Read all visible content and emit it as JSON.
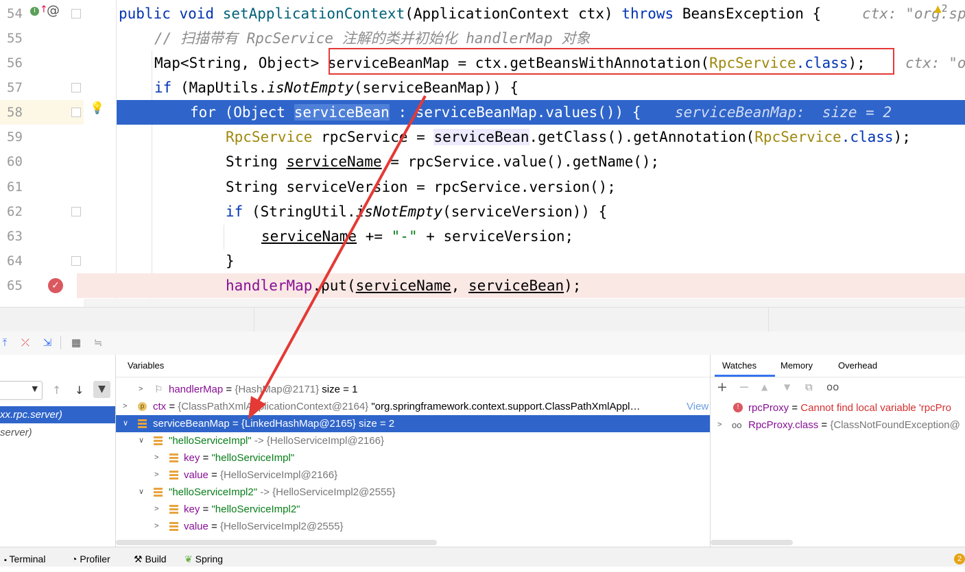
{
  "editor": {
    "lines": [
      {
        "num": "54"
      },
      {
        "num": "55"
      },
      {
        "num": "56"
      },
      {
        "num": "57"
      },
      {
        "num": "58"
      },
      {
        "num": "59"
      },
      {
        "num": "60"
      },
      {
        "num": "61"
      },
      {
        "num": "62"
      },
      {
        "num": "63"
      },
      {
        "num": "64"
      },
      {
        "num": "65"
      }
    ],
    "line54": {
      "t1": "public void ",
      "t2": "setApplicationContext",
      "t3": "(ApplicationContext ctx) ",
      "t4": "throws ",
      "t5": "BeansException {",
      "hint": "ctx: \"org.sp"
    },
    "line55": {
      "comment": "// 扫描带有 RpcService 注解的类并初始化 handlerMap 对象"
    },
    "line56": {
      "t1": "Map<String, Object> ",
      "t2": "serviceBeanMap = ctx.getBeansWithAnnotation(",
      "t3": "RpcService",
      "t4": ".class",
      "t5": ");",
      "hint": "ctx: \"o"
    },
    "line57": {
      "t1": "if ",
      "t2": "(MapUtils.",
      "t3": "isNotEmpty",
      "t4": "(serviceBeanMap)) {"
    },
    "line58": {
      "t1": "for ",
      "t2": "(Object ",
      "t3": "serviceBean",
      "t4": " : serviceBeanMap.values()) {",
      "hint": "serviceBeanMap:  size = 2"
    },
    "line59": {
      "t1": "RpcService",
      "t2": " rpcService = ",
      "t3": "serviceBean",
      "t4": ".getClass().getAnnotation(",
      "t5": "RpcService",
      ".class": "",
      "t6": ".class",
      "t7": ");"
    },
    "line60": {
      "t1": "String ",
      "t2": "serviceName",
      "t3": " = rpcService.value().getName();"
    },
    "line61": {
      "t1": "String serviceVersion = rpcService.version();"
    },
    "line62": {
      "t1": "if ",
      "t2": "(StringUtil.",
      "t3": "isNotEmpty",
      "t4": "(serviceVersion)) {"
    },
    "line63": {
      "t1": "serviceName",
      "t2": " += ",
      "t3": "\"-\"",
      "t4": " + serviceVersion;"
    },
    "line64": {
      "t1": "}"
    },
    "line65": {
      "t1": "handlerMap",
      "t2": ".put(",
      "t3": "serviceName",
      ", ": "",
      "t4": ", ",
      "t5": "serviceBean",
      "t6": ");"
    },
    "warnings": "2"
  },
  "variables": {
    "header": "Variables",
    "rows": [
      {
        "name": "handlerMap",
        "eq": " = ",
        "val": "{HashMap@2171}",
        "extra": "  size = 1"
      },
      {
        "name": "ctx",
        "eq": " = ",
        "val": "{ClassPathXmlApplicationContext@2164}",
        "extra": " \"org.springframework.context.support.ClassPathXmlAppl…",
        "link": "View"
      },
      {
        "name": "serviceBeanMap",
        "eq": " = ",
        "val": "{LinkedHashMap@2165}",
        "extra": "  size = 2"
      },
      {
        "name": "\"helloServiceImpl\"",
        "eq": " -> ",
        "val": "{HelloServiceImpl@2166}",
        "extra": ""
      },
      {
        "name": "key",
        "eq": " = ",
        "val": "\"helloServiceImpl\"",
        "extra": ""
      },
      {
        "name": "value",
        "eq": " = ",
        "val": "{HelloServiceImpl@2166}",
        "extra": ""
      },
      {
        "name": "\"helloServiceImpl2\"",
        "eq": " -> ",
        "val": "{HelloServiceImpl2@2555}",
        "extra": ""
      },
      {
        "name": "key",
        "eq": " = ",
        "val": "\"helloServiceImpl2\"",
        "extra": ""
      },
      {
        "name": "value",
        "eq": " = ",
        "val": "{HelloServiceImpl2@2555}",
        "extra": ""
      }
    ]
  },
  "frames": {
    "item1": "xx.rpc.server)",
    "item2": "server)"
  },
  "watches": {
    "tabs": [
      "Watches",
      "Memory",
      "Overhead"
    ],
    "rows": [
      {
        "name": "rpcProxy",
        "eq": " = ",
        "val": "Cannot find local variable 'rpcPro"
      },
      {
        "name": "RpcProxy.class",
        "eq": " = ",
        "val": "{ClassNotFoundException@"
      }
    ]
  },
  "bottom": {
    "tabs": [
      "Terminal",
      "Profiler",
      "Build",
      "Spring"
    ],
    "badge": "2"
  },
  "colors": {
    "selection": "#2f65ca",
    "highlight_box": "#e53935",
    "arrow": "#e53935"
  }
}
